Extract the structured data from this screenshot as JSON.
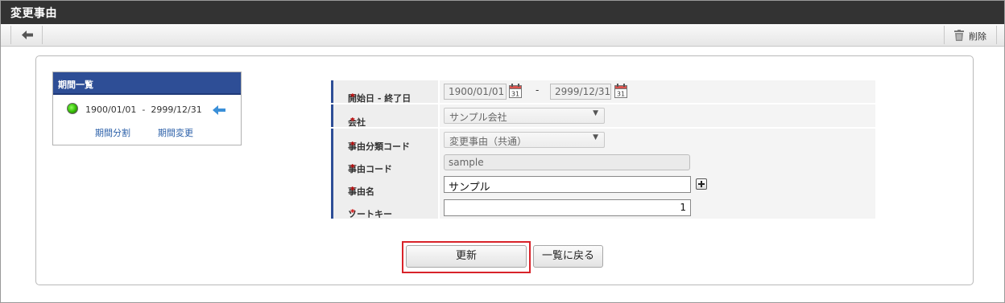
{
  "window": {
    "title": "変更事由"
  },
  "toolbar": {
    "back_icon": "arrow-left-icon",
    "delete_label": "削除",
    "delete_icon": "trash-icon"
  },
  "period_list": {
    "title": "期間一覧",
    "status_icon": "active-status-icon",
    "range": "1900/01/01  -  2999/12/31",
    "selected_icon": "arrow-left-icon",
    "split_link": "期間分割",
    "change_link": "期間変更"
  },
  "form": {
    "period": {
      "label": "開始日 - 終了日",
      "required_mark": "*",
      "start": "1900/01/01",
      "separator": "-",
      "end": "2999/12/31",
      "calendar_icon": "calendar-icon",
      "calendar_day": "31"
    },
    "company": {
      "label": "会社",
      "required_mark": "*",
      "value": "サンプル会社"
    },
    "reason_category": {
      "label": "事由分類コード",
      "required_mark": "*",
      "value": "変更事由（共通）"
    },
    "reason_code": {
      "label": "事由コード",
      "required_mark": "*",
      "value": "sample"
    },
    "reason_name": {
      "label": "事由名",
      "required_mark": "*",
      "value": "サンプル"
    },
    "sort_key": {
      "label": "ソートキー",
      "required_mark": "*",
      "value": "1"
    }
  },
  "actions": {
    "update_label": "更新",
    "back_to_list_label": "一覧に戻る"
  },
  "colors": {
    "title_bar": "#333333",
    "accent": "#2e4e96",
    "highlight": "#d8232a",
    "required": "#cc0000",
    "link": "#2a5fa8"
  }
}
